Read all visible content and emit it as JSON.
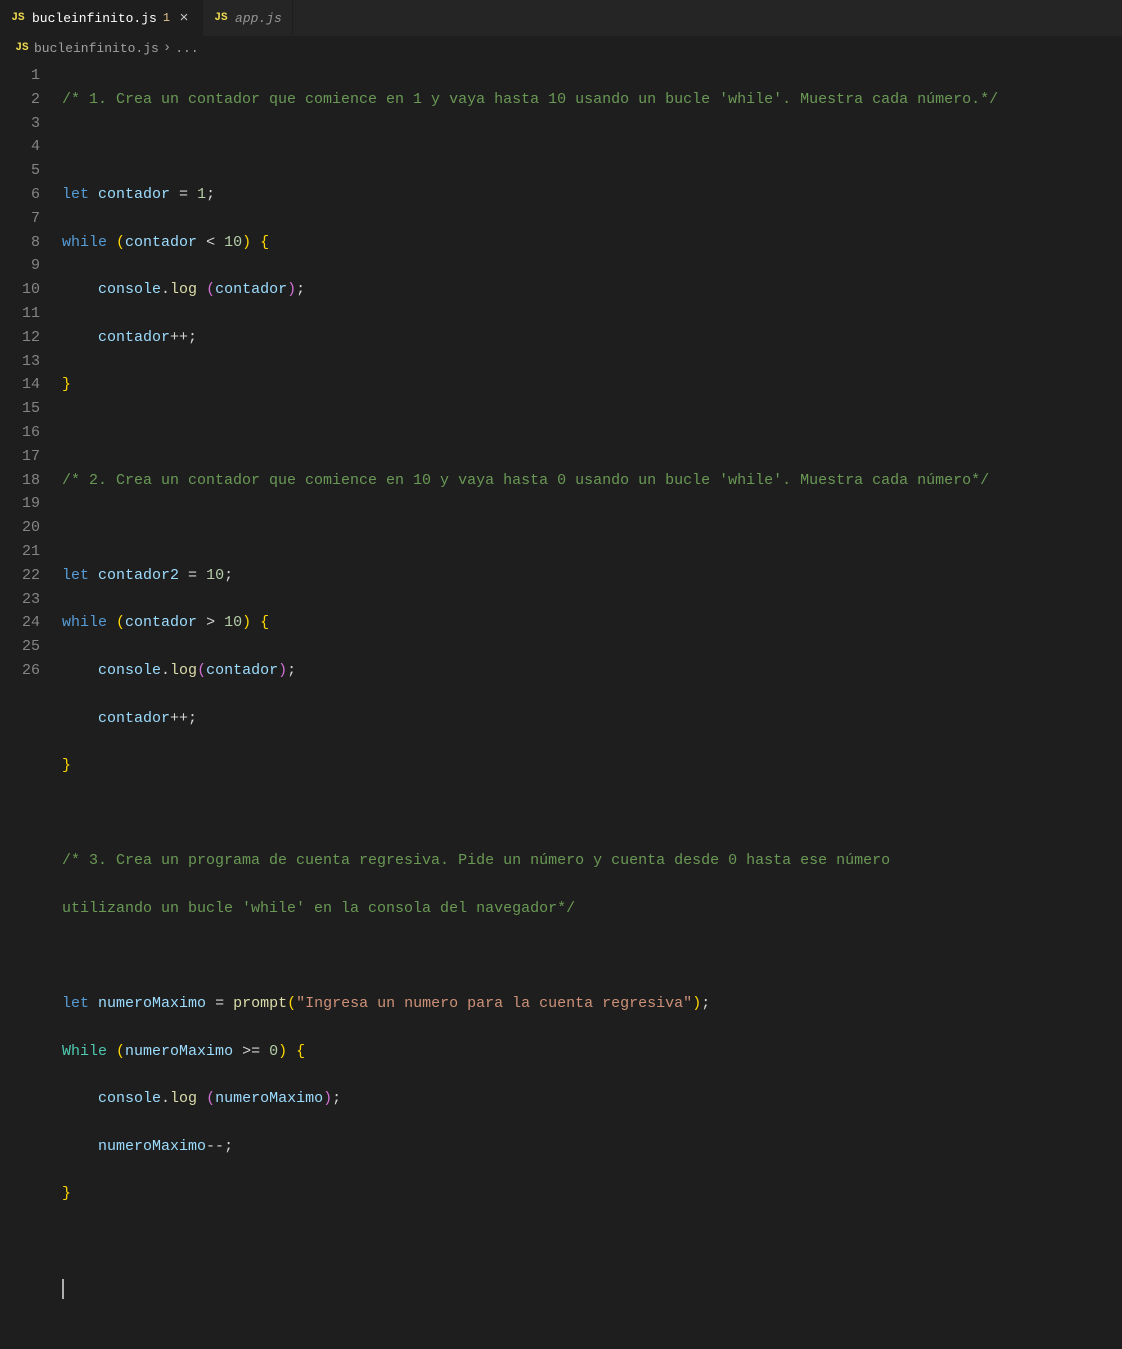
{
  "tabs": [
    {
      "icon": "JS",
      "name": "bucleinfinito.js",
      "dirty": "1",
      "close": "×",
      "active": true
    },
    {
      "icon": "JS",
      "name": "app.js",
      "dirty": "",
      "close": "",
      "active": false
    }
  ],
  "breadcrumb": {
    "icon": "JS",
    "file": "bucleinfinito.js",
    "chevron": "›",
    "rest": "..."
  },
  "lineNumbers": [
    "1",
    "2",
    "3",
    "4",
    "5",
    "6",
    "7",
    "8",
    "9",
    "10",
    "11",
    "12",
    "13",
    "14",
    "15",
    "16",
    "17",
    "18",
    "19",
    "20",
    "21",
    "22",
    "23",
    "24",
    "25",
    "26"
  ],
  "code": {
    "l1": "/* 1. Crea un contador que comience en 1 y vaya hasta 10 usando un bucle 'while'. Muestra cada número.*/",
    "l3_let": "let",
    "l3_var": "contador",
    "l3_eq": " = ",
    "l3_num": "1",
    "l4_while": "while",
    "l4_var": "contador",
    "l4_op": " < ",
    "l4_num": "10",
    "l5_console": "console",
    "l5_dot": ".",
    "l5_log": "log",
    "l5_sp": " ",
    "l5_arg": "contador",
    "l6_var": "contador",
    "l6_op": "++",
    "l9": "/* 2. Crea un contador que comience en 10 y vaya hasta 0 usando un bucle 'while'. Muestra cada número*/",
    "l11_let": "let",
    "l11_var": "contador2",
    "l11_eq": " = ",
    "l11_num": "10",
    "l12_while": "while",
    "l12_var": "contador",
    "l12_op": " > ",
    "l12_num": "10",
    "l13_console": "console",
    "l13_log": "log",
    "l13_arg": "contador",
    "l14_var": "contador",
    "l14_op": "++",
    "l17": "/* 3. Crea un programa de cuenta regresiva. Pide un número y cuenta desde 0 hasta ese número ",
    "l18": "utilizando un bucle 'while' en la consola del navegador*/",
    "l20_let": "let",
    "l20_var": "numeroMaximo",
    "l20_eq": " = ",
    "l20_func": "prompt",
    "l20_str": "\"Ingresa un numero para la cuenta regresiva\"",
    "l21_while": "While",
    "l21_var": "numeroMaximo",
    "l21_op": " >= ",
    "l21_num": "0",
    "l22_console": "console",
    "l22_log": "log",
    "l22_sp": " ",
    "l22_arg": "numeroMaximo",
    "l23_var": "numeroMaximo",
    "l23_op": "--",
    "semi": ";",
    "lparen": "(",
    "rparen": ")",
    "lbrace": "{",
    "rbrace": "}",
    "indent1": "    ",
    "space": " "
  }
}
